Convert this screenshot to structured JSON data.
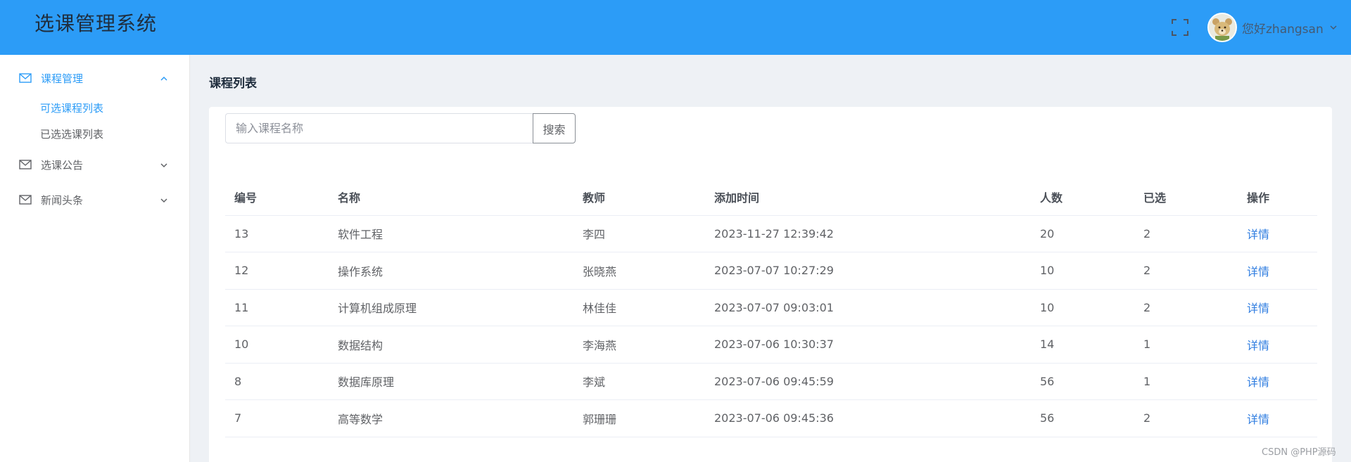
{
  "header": {
    "app_title": "选课管理系统",
    "greeting": "您好zhangsan",
    "accent_color": "#2c9cf7"
  },
  "sidebar": {
    "menus": [
      {
        "label": "课程管理",
        "icon": "envelope-icon",
        "expanded": true
      },
      {
        "label": "选课公告",
        "icon": "envelope-icon",
        "expanded": false
      },
      {
        "label": "新闻头条",
        "icon": "envelope-icon",
        "expanded": false
      }
    ],
    "submenu": [
      {
        "label": "可选课程列表",
        "active": true
      },
      {
        "label": "已选选课列表",
        "active": false
      }
    ],
    "active_color": "#2c9cf7"
  },
  "main": {
    "heading": "课程列表",
    "search": {
      "placeholder": "输入课程名称",
      "value": "",
      "button_label": "搜索"
    },
    "table": {
      "columns": [
        "编号",
        "名称",
        "教师",
        "添加时间",
        "人数",
        "已选",
        "操作"
      ],
      "rows": [
        {
          "id": "13",
          "name": "软件工程",
          "teacher": "李四",
          "added": "2023-11-27 12:39:42",
          "capacity": "20",
          "selected": "2",
          "action": "详情"
        },
        {
          "id": "12",
          "name": "操作系统",
          "teacher": "张晓燕",
          "added": "2023-07-07 10:27:29",
          "capacity": "10",
          "selected": "2",
          "action": "详情"
        },
        {
          "id": "11",
          "name": "计算机组成原理",
          "teacher": "林佳佳",
          "added": "2023-07-07 09:03:01",
          "capacity": "10",
          "selected": "2",
          "action": "详情"
        },
        {
          "id": "10",
          "name": "数据结构",
          "teacher": "李海燕",
          "added": "2023-07-06 10:30:37",
          "capacity": "14",
          "selected": "1",
          "action": "详情"
        },
        {
          "id": "8",
          "name": "数据库原理",
          "teacher": "李斌",
          "added": "2023-07-06 09:45:59",
          "capacity": "56",
          "selected": "1",
          "action": "详情"
        },
        {
          "id": "7",
          "name": "高等数学",
          "teacher": "郭珊珊",
          "added": "2023-07-06 09:45:36",
          "capacity": "56",
          "selected": "2",
          "action": "详情"
        }
      ]
    }
  },
  "watermark": "CSDN @PHP源码"
}
